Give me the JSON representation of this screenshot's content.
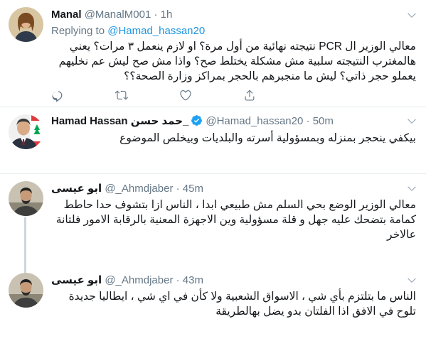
{
  "tweets": [
    {
      "name": "Manal",
      "handle": "@ManalM001",
      "dot": "·",
      "time": "1h",
      "reply_prefix": "Replying to",
      "reply_mention": "@Hamad_hassan20",
      "text": "معالي الوزير ال PCR نتيجته نهائية من أول مرة؟ او لازم ينعمل ٣ مرات؟ يعني هالمغترب النتيجته سلبية مش مشكلة يختلط صح؟ واذا مش صح ليش عم نخليهم يعملو حجر ذاتي؟ ليش ما منجبرهم بالحجر بمراكز وزارة الصحة؟؟"
    },
    {
      "name_en": "Hamad Hassan",
      "name_ar": "حمد حسن_",
      "handle": "@Hamad_hassan20",
      "dot": "·",
      "time": "50m",
      "verified": true,
      "text": "بيكفي ينحجر بمنزله وبمسؤولية أسرته والبلديات وبيخلص الموضوع"
    },
    {
      "name": "ابو عيسى",
      "handle": "@_Ahmdjaber",
      "dot": "·",
      "time": "45m",
      "text": "معالي الوزير الوضع بحي السلم مش طبيعي ابدا ، الناس ازا بتشوف حدا حاطط كمامة بتضحك عليه جهل و قلة مسؤولية وين الاجهزة المعنية بالرقابة الامور فلتانة عالاخر"
    },
    {
      "name": "ابو عيسى",
      "handle": "@_Ahmdjaber",
      "dot": "·",
      "time": "43m",
      "text": "الناس ما بتلتزم بأي شي ، الاسواق الشعبية ولا كأن في اي شي ، ايطاليا جديدة تلوح في الافق اذا الفلتان بدو يضل بهالطريقة"
    }
  ],
  "icons": [
    "reply-icon",
    "retweet-icon",
    "like-icon",
    "share-icon",
    "chevron-down-icon",
    "verified-badge-icon"
  ],
  "colors": {
    "accent": "#1b95e0",
    "secondary_text": "#657786",
    "divider": "#e6ecf0",
    "verified": "#1da1f2"
  }
}
